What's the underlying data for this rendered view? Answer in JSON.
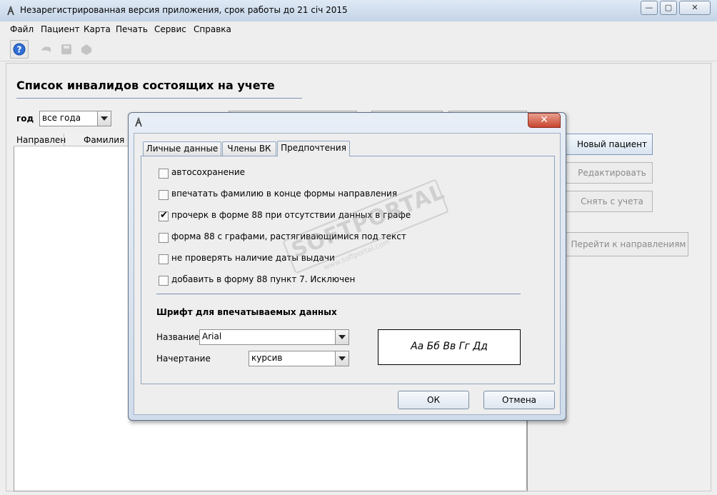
{
  "window": {
    "title": "Незарегистрированная версия приложения, срок работы до 21 січ 2015",
    "minimize": "—",
    "maximize": "▢",
    "close": "✕"
  },
  "menu": [
    "Файл",
    "Пациент",
    "Карта",
    "Печать",
    "Сервис",
    "Справка"
  ],
  "main": {
    "title": "Список инвалидов состоящих на учете",
    "year_label": "год",
    "year_value": "все года",
    "columns": [
      "Направлен",
      "Фамилия И"
    ]
  },
  "side_buttons": {
    "new_patient": "Новый пациент",
    "edit": "Редактировать",
    "remove": "Снять с учета",
    "goto_referrals": "Перейти к направлениям"
  },
  "dialog": {
    "close": "✕",
    "tabs": [
      "Личные данные",
      "Члены ВК",
      "Предпочтения"
    ],
    "active_tab": "Предпочтения",
    "options": [
      {
        "label": "автосохранение",
        "checked": false
      },
      {
        "label": "впечатать фамилию в конце формы направления",
        "checked": false
      },
      {
        "label": "прочерк в форме 88 при отсутствии данных в графе",
        "checked": true
      },
      {
        "label": "форма 88 с графами, растягивающимися под текст",
        "checked": false
      },
      {
        "label": "не проверять наличие даты выдачи",
        "checked": false
      },
      {
        "label": "добавить в форму 88 пункт 7. Исключен",
        "checked": false
      }
    ],
    "font_section_title": "Шрифт для впечатываемых данных",
    "font_name_label": "Название",
    "font_name_value": "Arial",
    "font_style_label": "Начертание",
    "font_style_value": "курсив",
    "preview_text": "Аа Бб Вв Гг Дд",
    "ok": "ОК",
    "cancel": "Отмена"
  },
  "watermark": {
    "text": "SOFTPORTAL",
    "url": "www.softportal.com"
  }
}
